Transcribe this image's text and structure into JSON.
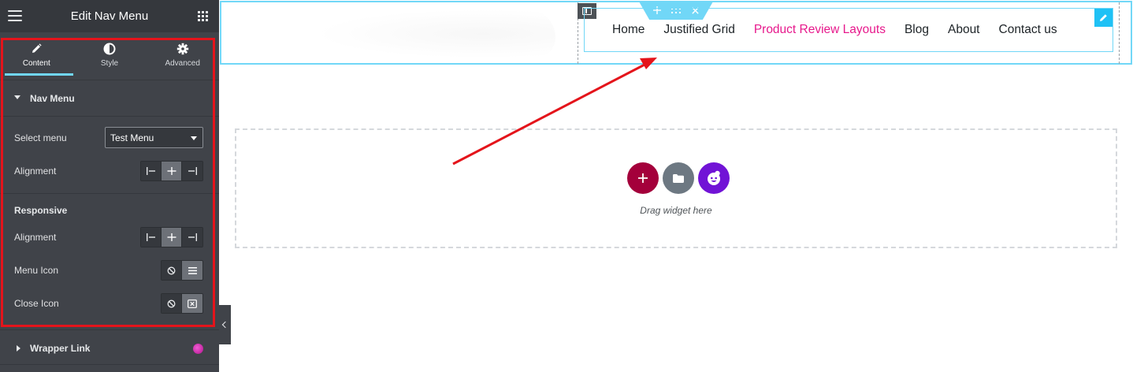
{
  "panel": {
    "title": "Edit Nav Menu",
    "tabs": [
      {
        "label": "Content",
        "icon": "pencil-icon",
        "active": true
      },
      {
        "label": "Style",
        "icon": "half-circle-icon",
        "active": false
      },
      {
        "label": "Advanced",
        "icon": "gear-icon",
        "active": false
      }
    ],
    "section_nav_menu": "Nav Menu",
    "select_menu_label": "Select menu",
    "select_menu_value": "Test Menu",
    "alignment_label": "Alignment",
    "responsive_heading": "Responsive",
    "responsive_alignment_label": "Alignment",
    "menu_icon_label": "Menu Icon",
    "close_icon_label": "Close Icon",
    "section_wrapper_link": "Wrapper Link"
  },
  "canvas": {
    "nav_items": [
      "Home",
      "Justified Grid",
      "Product Review Layouts",
      "Blog",
      "About",
      "Contact us"
    ],
    "active_nav_item": "Product Review Layouts",
    "drop_text": "Drag widget here"
  },
  "colors": {
    "panel_bg": "#404349",
    "accent_blue": "#71d7f7",
    "active_link": "#e7198c",
    "add_button": "#a4003b",
    "template_button": "#6d7882",
    "kit_button": "#7113d6",
    "annotation_red": "#e4141b"
  }
}
